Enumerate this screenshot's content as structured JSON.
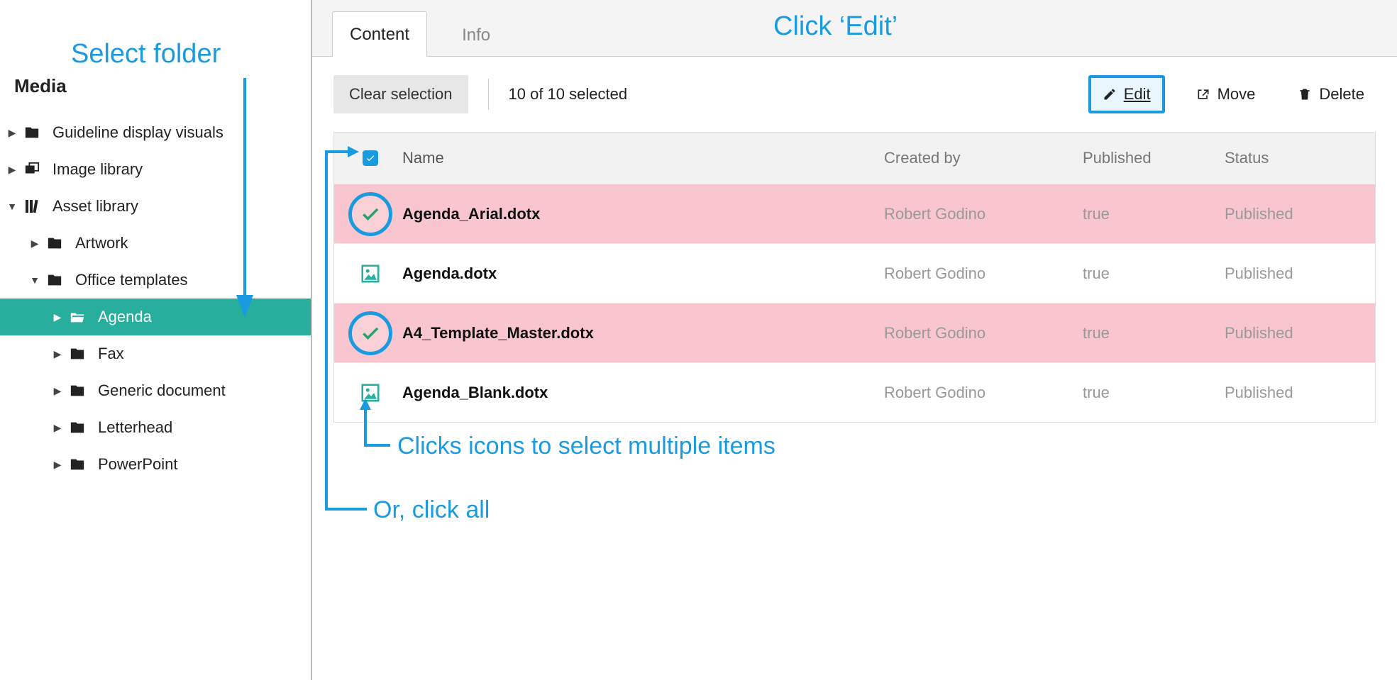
{
  "sidebar": {
    "title": "Media",
    "items": [
      {
        "label": "Guideline display visuals",
        "icon": "folder",
        "depth": 0,
        "caret": "right",
        "active": false
      },
      {
        "label": "Image library",
        "icon": "images",
        "depth": 0,
        "caret": "right",
        "active": false
      },
      {
        "label": "Asset library",
        "icon": "library",
        "depth": 0,
        "caret": "down",
        "active": false
      },
      {
        "label": "Artwork",
        "icon": "folder",
        "depth": 1,
        "caret": "right",
        "active": false
      },
      {
        "label": "Office templates",
        "icon": "folder",
        "depth": 1,
        "caret": "down",
        "active": false
      },
      {
        "label": "Agenda",
        "icon": "folder-open",
        "depth": 2,
        "caret": "right",
        "active": true
      },
      {
        "label": "Fax",
        "icon": "folder",
        "depth": 2,
        "caret": "right",
        "active": false
      },
      {
        "label": "Generic document",
        "icon": "folder",
        "depth": 2,
        "caret": "right",
        "active": false
      },
      {
        "label": "Letterhead",
        "icon": "folder",
        "depth": 2,
        "caret": "right",
        "active": false
      },
      {
        "label": "PowerPoint",
        "icon": "folder",
        "depth": 2,
        "caret": "right",
        "active": false
      }
    ]
  },
  "tabs": [
    {
      "label": "Content",
      "active": true
    },
    {
      "label": "Info",
      "active": false
    }
  ],
  "toolbar": {
    "clear": "Clear selection",
    "selection_status": "10 of 10 selected",
    "edit": "Edit",
    "move": "Move",
    "delete": "Delete"
  },
  "table": {
    "headers": {
      "name": "Name",
      "created_by": "Created by",
      "published": "Published",
      "status": "Status"
    },
    "rows": [
      {
        "name": "Agenda_Arial.dotx",
        "created_by": "Robert Godino",
        "published": "true",
        "status": "Published",
        "selected": true
      },
      {
        "name": "Agenda.dotx",
        "created_by": "Robert Godino",
        "published": "true",
        "status": "Published",
        "selected": false
      },
      {
        "name": "A4_Template_Master.dotx",
        "created_by": "Robert Godino",
        "published": "true",
        "status": "Published",
        "selected": true
      },
      {
        "name": "Agenda_Blank.dotx",
        "created_by": "Robert Godino",
        "published": "true",
        "status": "Published",
        "selected": false
      }
    ]
  },
  "annotations": {
    "select_folder": "Select folder",
    "click_edit": "Click ‘Edit’",
    "click_icons": "Clicks icons to select multiple items",
    "click_all": "Or, click all"
  }
}
